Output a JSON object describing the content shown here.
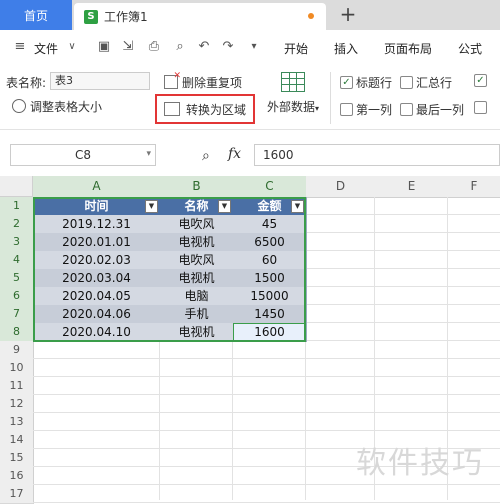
{
  "tabs": {
    "home": "首页",
    "doc": "工作簿1",
    "doc_icon": "S"
  },
  "menu": {
    "file": "文件",
    "items": [
      "开始",
      "插入",
      "页面布局",
      "公式"
    ]
  },
  "ribbon": {
    "table_name_label": "表名称:",
    "table_name_value": "表3",
    "resize_table": "调整表格大小",
    "remove_duplicates": "删除重复项",
    "convert_to_range": "转换为区域",
    "external_data": "外部数据",
    "checkboxes": [
      {
        "label": "标题行",
        "checked": true
      },
      {
        "label": "汇总行",
        "checked": false
      },
      {
        "label": "第一列",
        "checked": false
      },
      {
        "label": "最后一列",
        "checked": false
      }
    ]
  },
  "formula_bar": {
    "name_box": "C8",
    "fx": "fx",
    "value": "1600"
  },
  "grid": {
    "columns": [
      "A",
      "B",
      "C",
      "D",
      "E",
      "F"
    ],
    "rows": [
      "1",
      "2",
      "3",
      "4",
      "5",
      "6",
      "7",
      "8",
      "9",
      "10",
      "11",
      "12",
      "13",
      "14",
      "15",
      "16",
      "17"
    ],
    "table": {
      "headers": [
        "时间",
        "名称",
        "金额"
      ],
      "rows": [
        [
          "2019.12.31",
          "电吹风",
          "45"
        ],
        [
          "2020.01.01",
          "电视机",
          "6500"
        ],
        [
          "2020.02.03",
          "电吹风",
          "60"
        ],
        [
          "2020.03.04",
          "电视机",
          "1500"
        ],
        [
          "2020.04.05",
          "电脑",
          "15000"
        ],
        [
          "2020.04.06",
          "手机",
          "1450"
        ],
        [
          "2020.04.10",
          "电视机",
          "1600"
        ]
      ]
    }
  },
  "watermark": "软件技巧",
  "colors": {
    "accent": "#3f7ee8",
    "table_header": "#4a6fa5",
    "highlight_border": "#e23535",
    "selection": "#3a9d4a"
  }
}
